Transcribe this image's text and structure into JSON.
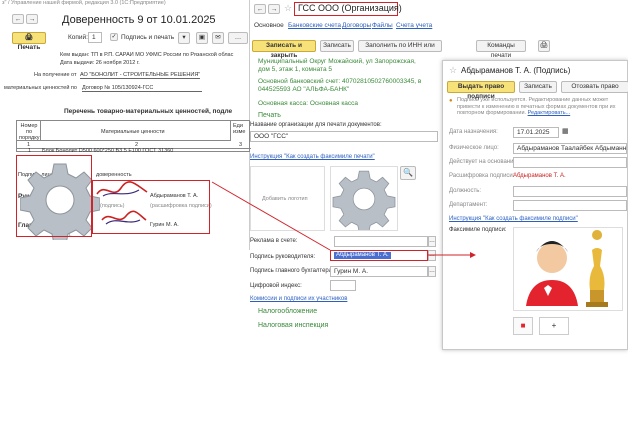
{
  "left_window": {
    "titlebar": "з\" / Управление нашей фирмой, редакция 3.0  (1С:Предприятие)",
    "doc_title": "Доверенность 9 от 10.01.2025",
    "print_btn": "Печать",
    "copies_label": "Копий:",
    "copies_value": "1",
    "sign_label": "Подпись и печать",
    "issued_line": "Кем выдан: ТП в Р.П. САРАИ МО УФМС России по Рязанской облас",
    "date_line": "Дата выдачи: 26 ноября 2012 г.",
    "receive_label": "На получение от",
    "receive_value": "АО \"БОНОЛИТ - СТРОИТЕЛЬНЫЕ РЕШЕНИЯ\"",
    "mat_label": "материальных ценностей по",
    "mat_value": "Договор № 105/130924-ГСС",
    "list_title": "Перечень товарно-материальных ценностей, подле",
    "col1": "Номер по порядку",
    "col2": "Материальные ценности",
    "col3": "Еди изме",
    "col_nums": [
      "1",
      "2",
      "3"
    ],
    "row1_n": "1",
    "row1_text": "Блок Бонолит D500 600*250 В3.5 F100 ГОСТ 31360",
    "sign_of": "Подпись лица",
    "cert": "доверенность",
    "head_label": "Руководитель",
    "head_name": "Абдыраманов Т. А.",
    "chief_label": "Главный",
    "chief_name": "Гурин М. А.",
    "sig_caption1": "(подпись)",
    "sig_caption2": "(расшифровка подписи)",
    "stamp": "М.П."
  },
  "middle_window": {
    "title": "ГСС ООО (Организация)",
    "tabs": [
      "Основное",
      "Банковские счета",
      "Договоры",
      "Файлы",
      "Счета учета"
    ],
    "btn_save_close": "Записать и закрыть",
    "btn_save": "Записать",
    "btn_fill_inn": "Заполнить по ИНН или наименованию",
    "btn_commands": "Команды печати",
    "address_line1": "Муниципальный Округ Можайский, ул Запорожская,",
    "address_line2": "дом 5, этаж 1, комната 5",
    "bank_line1": "Основной банковский счет: 40702810502760003345, в",
    "bank_line2": "044525593 АО \"АЛЬФА-БАНК\"",
    "cash_line": "Основная касса: Основная касса",
    "print_section": "Печать",
    "org_name_label": "Название организации для печати документов:",
    "org_name_value": "ООО \"ГСС\"",
    "fax_link": "Инструкция \"Как создать факсимиле печати\"",
    "upload_hint": "Добавить логотип",
    "ad_label": "Реклама в счете:",
    "head_sign_label": "Подпись руководителя:",
    "head_sign_value": "Абдыраманов Т. А.",
    "chief_sign_label": "Подпись главного бухгалтера:",
    "chief_sign_value": "Гурин М. А.",
    "digital_label": "Цифровой индекс:",
    "commissions_link": "Комиссии и подписи их участников",
    "tax_section": "Налогообложение",
    "inspection_section": "Налоговая инспекция"
  },
  "right_window": {
    "title": "Абдыраманов Т. А. (Подпись)",
    "btn_issue": "Выдать право подписи",
    "btn_save": "Записать",
    "btn_revoke": "Отозвать право подпи",
    "warning": "Подпись уже используется. Редактирование данных может привести к изменению в печатных формах документов при их повторном формировании.",
    "warning_link": "Редактировать...",
    "date_label": "Дата назначения:",
    "date_value": "17.01.2025",
    "person_label": "Физическое лицо:",
    "person_value": "Абдыраманов Таалайбек Абдыманнович",
    "basis_label": "Действует на основании:",
    "decode_label": "Расшифровка подписи:",
    "decode_value": "Абдыраманов Т. А.",
    "position_label": "Должность:",
    "dept_label": "Департамент:",
    "fax_link": "Инструкция \"Как создать факсимиле подписи\"",
    "facsimile_label": "Факсимиле подписи:",
    "thumb_add": "+"
  },
  "colors": {
    "accent_red": "#d2232a",
    "link_blue": "#2d5fbf",
    "button_yellow": "#f7e27a",
    "section_green": "#3a8a3a"
  }
}
